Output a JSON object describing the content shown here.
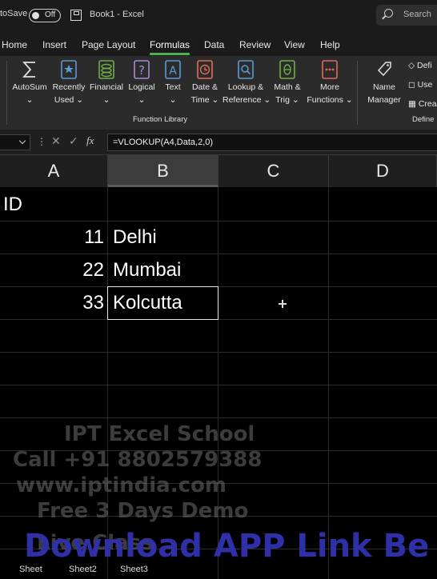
{
  "titlebar": {
    "autosave_label": "toSave",
    "toggle_state": "Off",
    "doc_title": "Book1  -  Excel",
    "search_placeholder": "Search"
  },
  "tabs": [
    "Home",
    "Insert",
    "Page Layout",
    "Formulas",
    "Data",
    "Review",
    "View",
    "Help"
  ],
  "active_tab": "Formulas",
  "ribbon": {
    "buttons": [
      {
        "line1": "AutoSum",
        "line2": "⌄",
        "icon": "sigma-icon"
      },
      {
        "line1": "Recently",
        "line2": "Used ⌄",
        "icon": "star-book-icon"
      },
      {
        "line1": "Financial",
        "line2": "⌄",
        "icon": "coins-icon"
      },
      {
        "line1": "Logical",
        "line2": "⌄",
        "icon": "question-book-icon"
      },
      {
        "line1": "Text",
        "line2": "⌄",
        "icon": "text-book-icon"
      },
      {
        "line1": "Date &",
        "line2": "Time ⌄",
        "icon": "clock-book-icon"
      },
      {
        "line1": "Lookup &",
        "line2": "Reference ⌄",
        "icon": "magnifier-book-icon"
      },
      {
        "line1": "Math &",
        "line2": "Trig ⌄",
        "icon": "theta-book-icon"
      },
      {
        "line1": "More",
        "line2": "Functions ⌄",
        "icon": "more-functions-icon"
      },
      {
        "line1": "Name",
        "line2": "Manager",
        "icon": "name-tag-icon"
      }
    ],
    "function_library_label": "Function Library",
    "defined_names_label": "Define",
    "mini": [
      "Defi",
      "Use",
      "Crea"
    ]
  },
  "formula_bar": {
    "formula": "=VLOOKUP(A4,Data,2,0)",
    "fx_label": "fx"
  },
  "grid": {
    "columns": [
      "A",
      "B",
      "C",
      "D"
    ],
    "selected_column": "B",
    "rows": [
      {
        "a": "ID",
        "b": ""
      },
      {
        "a": "11",
        "b": "Delhi"
      },
      {
        "a": "22",
        "b": "Mumbai"
      },
      {
        "a": "33",
        "b": "Kolcutta"
      }
    ]
  },
  "watermark": [
    "IPT Excel School",
    "Call +91 8802579388",
    "www.iptindia.com",
    "Free 3 Days Demo",
    "Live Class"
  ],
  "banner": "Download APP Link Be",
  "sheet_tabs": [
    "Sheet",
    "Sheet2",
    "Sheet3"
  ],
  "colors": {
    "accent": "#4caf50",
    "banner": "#2f2fa8"
  }
}
